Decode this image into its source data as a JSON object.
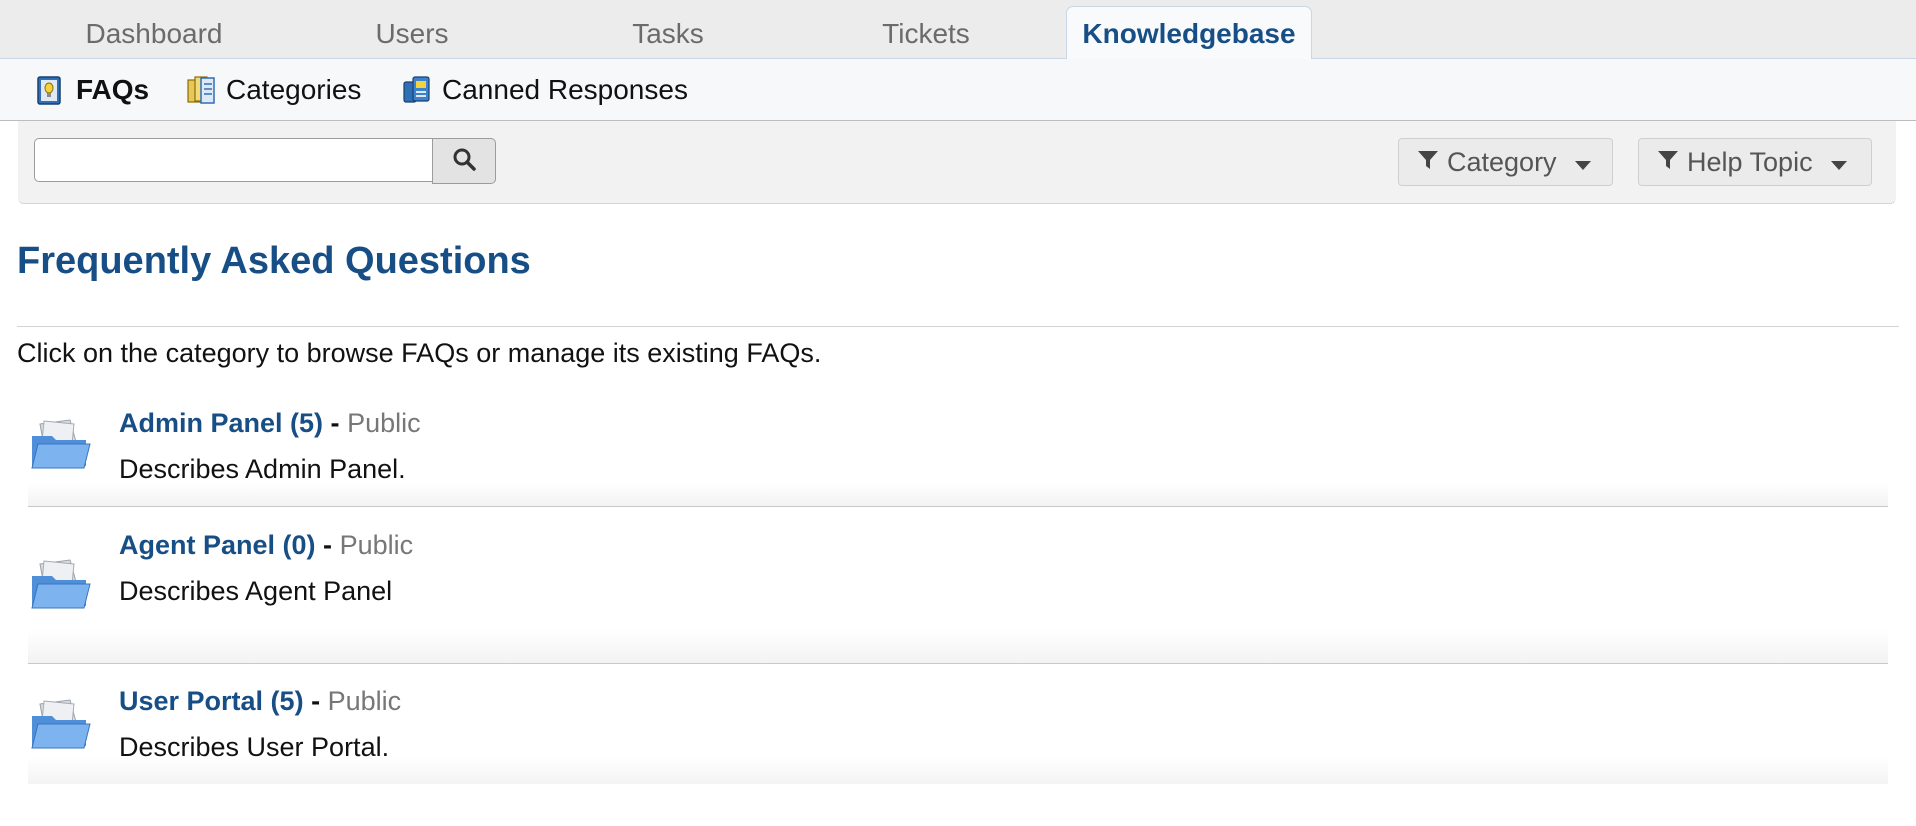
{
  "nav": {
    "tabs": [
      {
        "label": "Dashboard"
      },
      {
        "label": "Users"
      },
      {
        "label": "Tasks"
      },
      {
        "label": "Tickets"
      },
      {
        "label": "Knowledgebase",
        "active": true
      }
    ]
  },
  "subnav": {
    "items": [
      {
        "label": "FAQs",
        "icon": "faq-book-icon",
        "active": true
      },
      {
        "label": "Categories",
        "icon": "categories-icon"
      },
      {
        "label": "Canned Responses",
        "icon": "canned-responses-icon"
      }
    ]
  },
  "search": {
    "value": "",
    "placeholder": "",
    "button_icon": "magnifier-icon"
  },
  "filters": [
    {
      "label": "Category",
      "icon": "funnel-icon"
    },
    {
      "label": "Help Topic",
      "icon": "funnel-icon"
    }
  ],
  "page": {
    "title": "Frequently Asked Questions",
    "intro": "Click on the category to browse FAQs or manage its existing FAQs."
  },
  "categories": [
    {
      "name": "Admin Panel (5)",
      "separator": "-",
      "visibility": "Public",
      "description": "Describes Admin Panel."
    },
    {
      "name": "Agent Panel (0)",
      "separator": "-",
      "visibility": "Public",
      "description": "Describes Agent Panel"
    },
    {
      "name": "User Portal (5)",
      "separator": "-",
      "visibility": "Public",
      "description": "Describes User Portal."
    }
  ],
  "colors": {
    "link": "#184e86",
    "muted": "#777777",
    "nav_bg": "#ececec"
  }
}
